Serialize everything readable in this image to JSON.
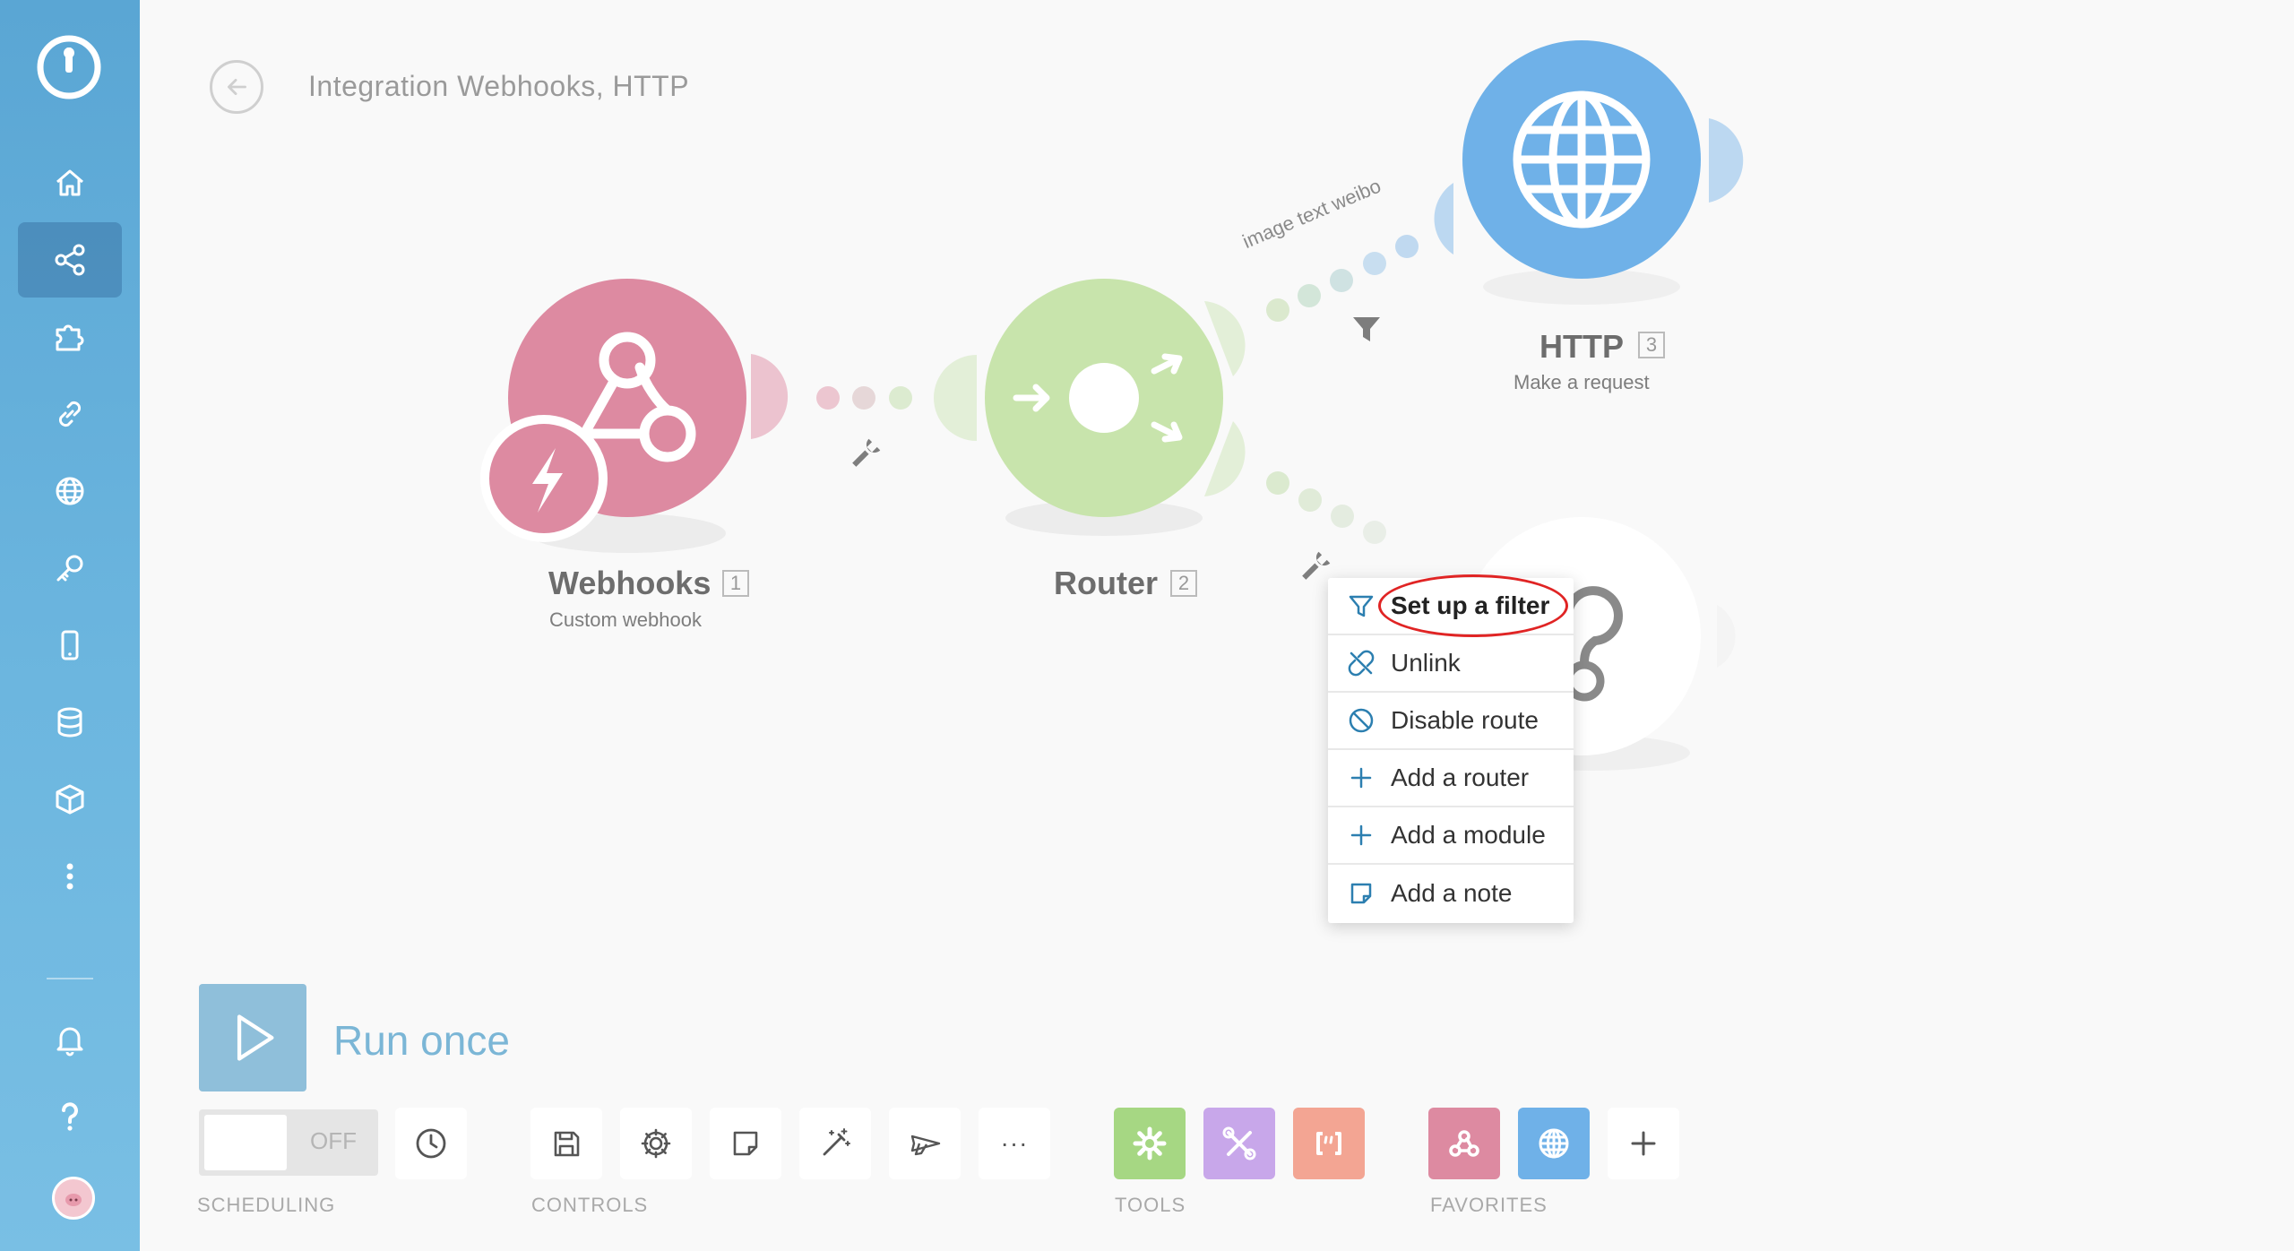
{
  "header": {
    "title": "Integration Webhooks, HTTP"
  },
  "modules": {
    "webhooks": {
      "name": "Webhooks",
      "num": "1",
      "sub": "Custom webhook"
    },
    "router": {
      "name": "Router",
      "num": "2"
    },
    "http": {
      "name": "HTTP",
      "num": "3",
      "sub": "Make a request"
    }
  },
  "route_label": "image text weibo",
  "context_menu": {
    "items": [
      {
        "label": "Set up a filter",
        "icon": "filter-icon"
      },
      {
        "label": "Unlink",
        "icon": "unlink-icon"
      },
      {
        "label": "Disable route",
        "icon": "disable-icon"
      },
      {
        "label": "Add a router",
        "icon": "plus-icon"
      },
      {
        "label": "Add a module",
        "icon": "plus-icon"
      },
      {
        "label": "Add a note",
        "icon": "note-icon"
      }
    ]
  },
  "bottom": {
    "run_label": "Run once",
    "toggle_label": "OFF",
    "sections": {
      "scheduling": "SCHEDULING",
      "controls": "CONTROLS",
      "tools": "TOOLS",
      "favorites": "FAVORITES"
    },
    "more_label": "···"
  },
  "colors": {
    "sidebar": "#6cb6df",
    "webhooks": "#dd8aa1",
    "router": "#c8e4ac",
    "http": "#6fb1e8",
    "accent": "#2c7fb0",
    "highlight": "#e02424"
  }
}
